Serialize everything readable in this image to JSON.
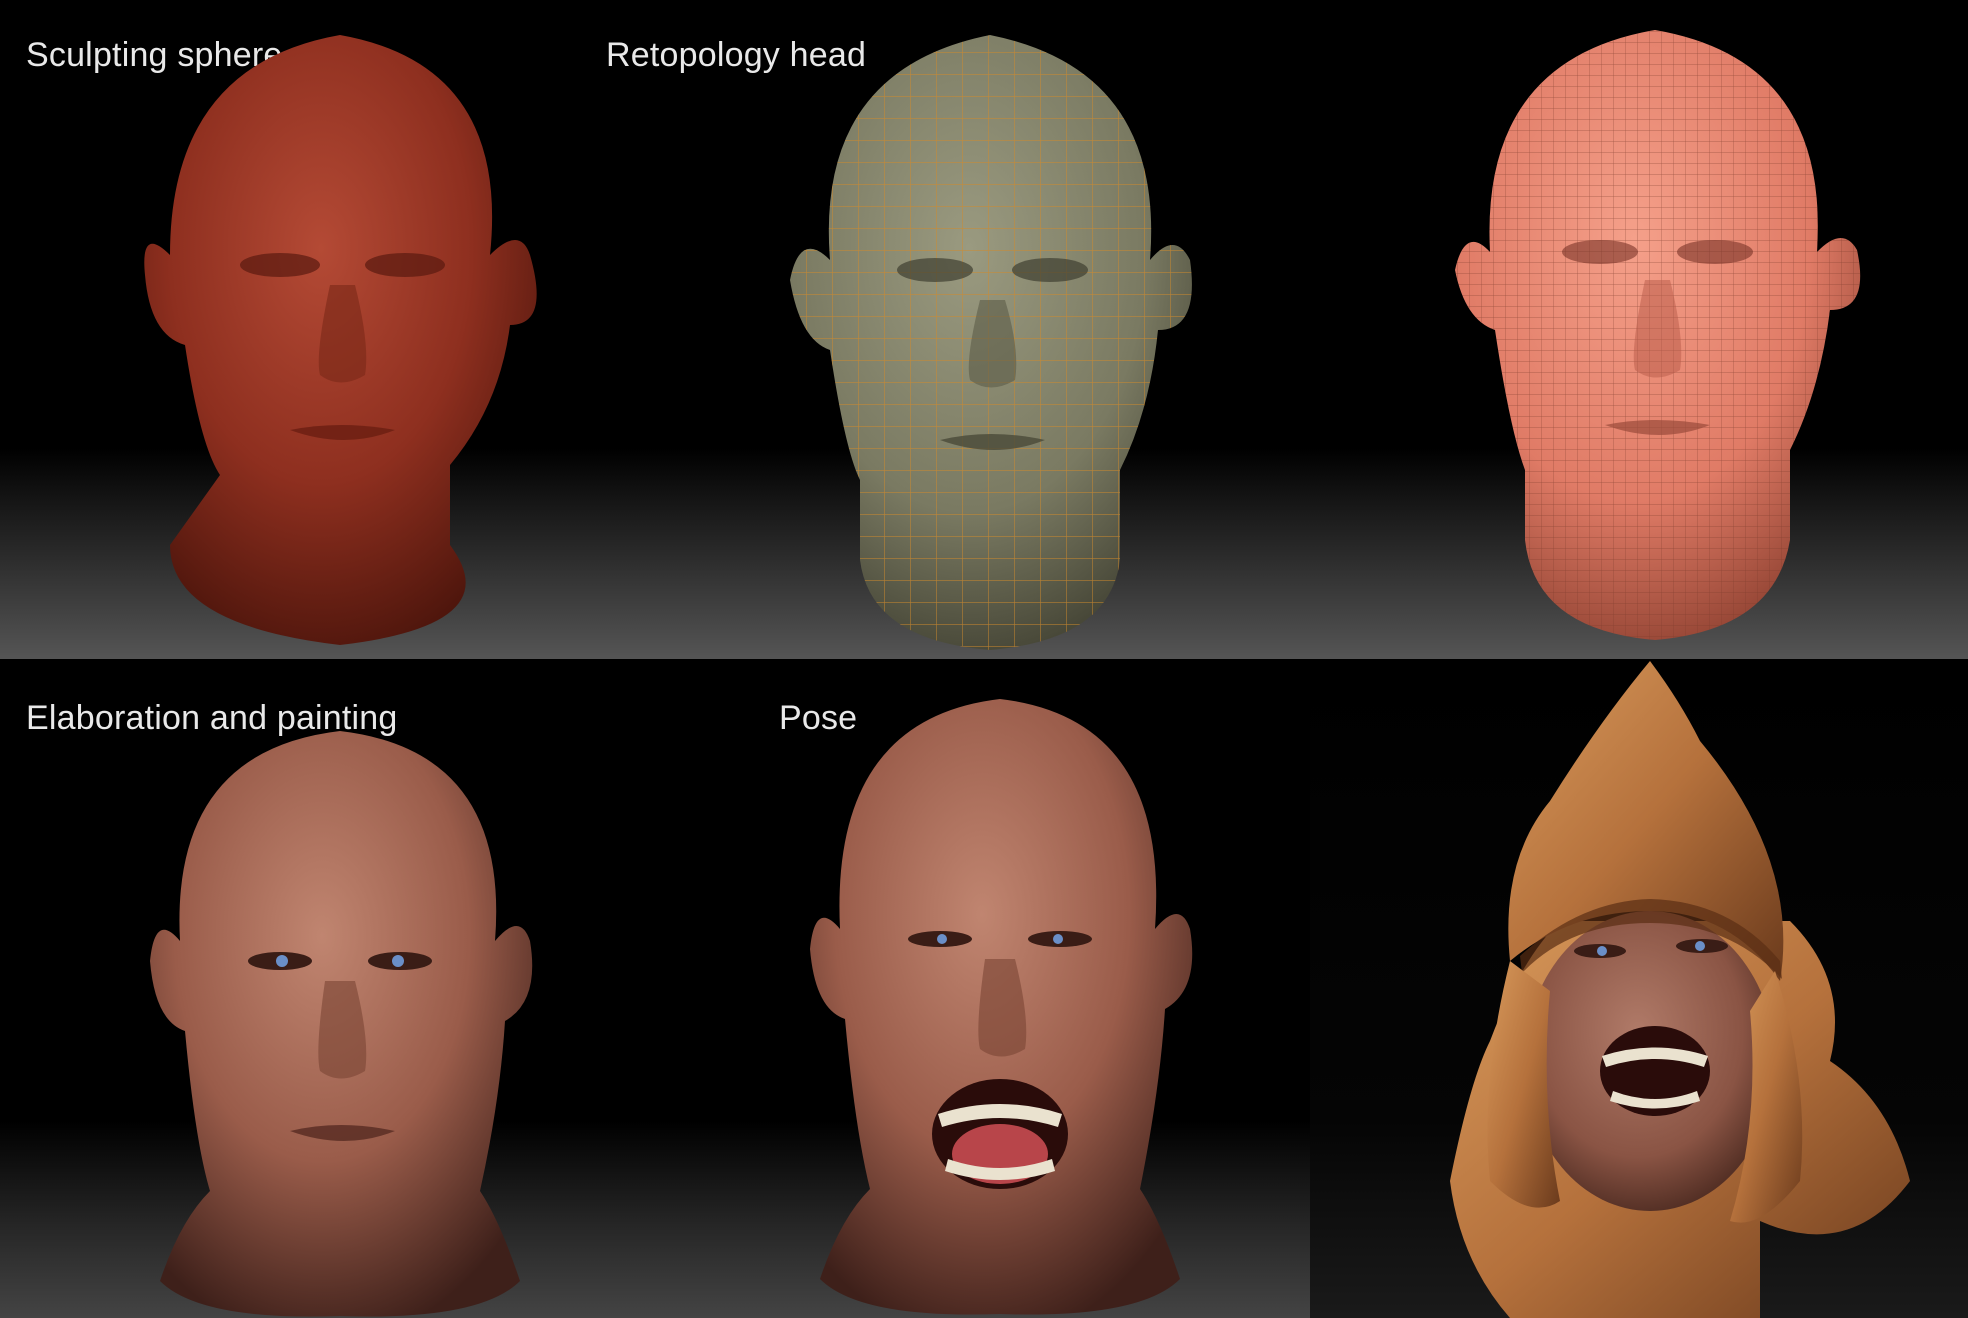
{
  "labels": {
    "sculpting": "Sculpting sphere",
    "retopology": "Retopology head",
    "elaboration": "Elaboration and painting",
    "pose": "Pose"
  },
  "colors": {
    "sculpt_red": "#8e2f1f",
    "retopo_gray": "#7a7a62",
    "wire_orange": "#d08a2c",
    "mesh_salmon": "#e07b66",
    "skin": "#9a5c4a",
    "helmet_gold": "#b5713c"
  }
}
